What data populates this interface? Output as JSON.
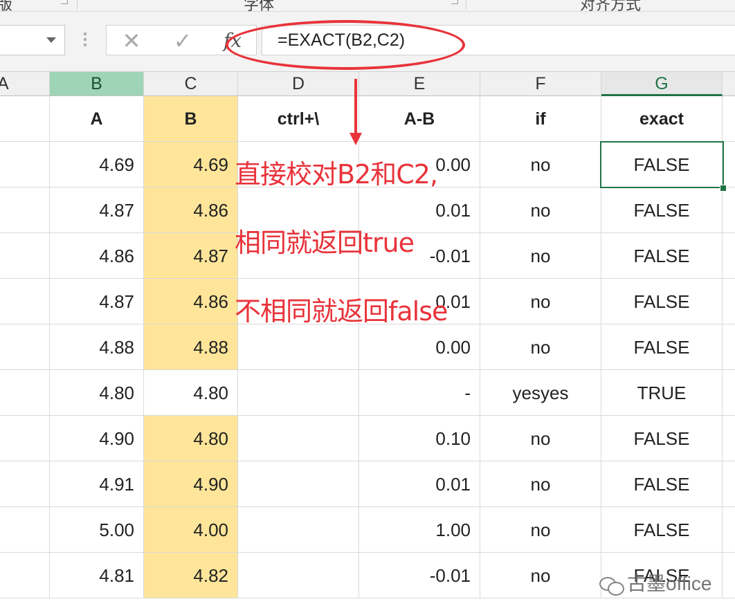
{
  "ribbon": {
    "groups": [
      "版",
      "字体",
      "对齐方式"
    ]
  },
  "formula_bar": {
    "name_box_value": "",
    "cancel_icon": "✕",
    "enter_icon": "✓",
    "fx_label": "fx",
    "formula": "=EXACT(B2,C2)"
  },
  "columns": [
    "A",
    "B",
    "C",
    "D",
    "E",
    "F",
    "G"
  ],
  "header_row": {
    "A": "",
    "B": "A",
    "C": "B",
    "D": "ctrl+\\",
    "E": "A-B",
    "F": "if",
    "G": "exact"
  },
  "rows": [
    {
      "B": "4.69",
      "C": "4.69",
      "D": "",
      "E": "0.00",
      "F": "no",
      "G": "FALSE"
    },
    {
      "B": "4.87",
      "C": "4.86",
      "D": "",
      "E": "0.01",
      "F": "no",
      "G": "FALSE"
    },
    {
      "B": "4.86",
      "C": "4.87",
      "D": "",
      "E": "-0.01",
      "F": "no",
      "G": "FALSE"
    },
    {
      "B": "4.87",
      "C": "4.86",
      "D": "",
      "E": "0.01",
      "F": "no",
      "G": "FALSE"
    },
    {
      "B": "4.88",
      "C": "4.88",
      "D": "",
      "E": "0.00",
      "F": "no",
      "G": "FALSE"
    },
    {
      "B": "4.80",
      "C": "4.80",
      "D": "",
      "E": "-",
      "F": "yesyes",
      "G": "TRUE"
    },
    {
      "B": "4.90",
      "C": "4.80",
      "D": "",
      "E": "0.10",
      "F": "no",
      "G": "FALSE"
    },
    {
      "B": "4.91",
      "C": "4.90",
      "D": "",
      "E": "0.01",
      "F": "no",
      "G": "FALSE"
    },
    {
      "B": "5.00",
      "C": "4.00",
      "D": "",
      "E": "1.00",
      "F": "no",
      "G": "FALSE"
    },
    {
      "B": "4.81",
      "C": "4.82",
      "D": "",
      "E": "-0.01",
      "F": "no",
      "G": "FALSE"
    }
  ],
  "highlighted_rows_col_c": [
    true,
    true,
    true,
    true,
    true,
    false,
    true,
    true,
    true,
    true
  ],
  "colors": {
    "highlight_yellow": "#fee599",
    "selected_header_green": "#9fd5b7",
    "active_border": "#217346",
    "annotation_red": "#e8333a"
  },
  "annotations": {
    "line1": "直接校对B2和C2,",
    "line2": "相同就返回true",
    "line3": "不相同就返回false"
  },
  "watermark": "古墨office"
}
